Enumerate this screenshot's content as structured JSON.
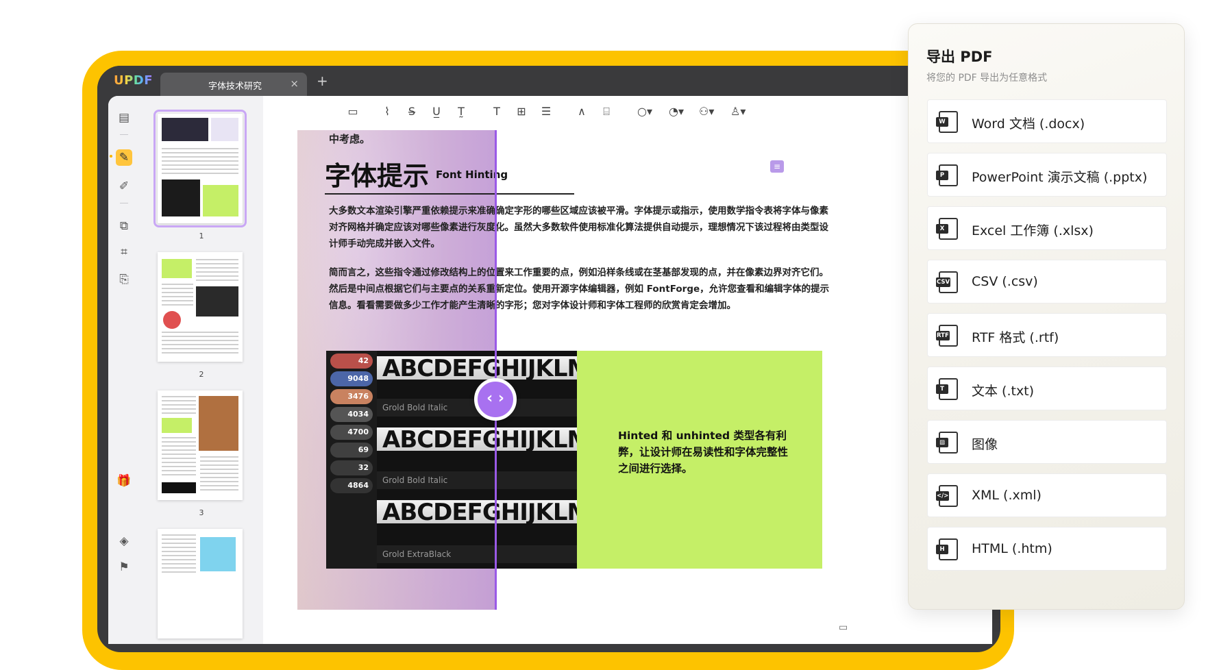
{
  "app": {
    "logo": "UPDF",
    "tab_title": "字体技术研究",
    "tab_close": "×",
    "tab_add": "+"
  },
  "thumbnails": [
    {
      "label": "1"
    },
    {
      "label": "2"
    },
    {
      "label": "3"
    }
  ],
  "page": {
    "top_line": "中考虑。",
    "title": "字体提示",
    "title_en": "Font Hinting",
    "paragraphs": [
      "大多数文本渲染引擎严重依赖提示来准确确定字形的哪些区域应该被平滑。字体提示或指示，使用数学指令表将字体与像素",
      "对齐网格并确定应该对哪些像素进行灰度化。虽然大多数软件使用标准化算法提供自动提示，理想情况下该过程将由类型设",
      "计师手动完成并嵌入文件。",
      "简而言之，这些指令通过修改结构上的位置来工作重要的点，例如沿样条线或在茎基部发现的点，并在像素边界对齐它们。",
      "然后是中间点根据它们与主要点的关系重新定位。使用开源字体编辑器，例如 FontForge，允许您查看和编辑字体的提示",
      "信息。看看需要做多少工作才能产生清晰的字形；您对字体设计师和字体工程师的欣赏肯定会增加。"
    ],
    "photo": {
      "counters": [
        "42",
        "9048",
        "3476",
        "4034",
        "4700",
        "69",
        "32",
        "4864"
      ],
      "rows": [
        {
          "text": "ABCDEFGHIJKLMNC",
          "sub": "Grold Bold Italic"
        },
        {
          "text": "ABCDEFGHIJKLMNC",
          "sub": "Grold Bold Italic"
        },
        {
          "text": "ABCDEFGHIJKLMNC",
          "sub": "Grold ExtraBlack"
        }
      ]
    },
    "lime_text": "Hinted 和 unhinted 类型各有利弊，让设计师在易读性和字体完整性之间进行选择。",
    "split_knob": "‹ ›"
  },
  "export_panel": {
    "title": "导出 PDF",
    "subtitle": "将您的 PDF 导出为任意格式",
    "options": [
      {
        "label": "Word 文档 (.docx)",
        "badge": "W",
        "icon": "word-icon"
      },
      {
        "label": "PowerPoint 演示文稿 (.pptx)",
        "badge": "P",
        "icon": "powerpoint-icon"
      },
      {
        "label": "Excel 工作簿 (.xlsx)",
        "badge": "X",
        "icon": "excel-icon"
      },
      {
        "label": "CSV (.csv)",
        "badge": "CSV",
        "icon": "csv-icon"
      },
      {
        "label": "RTF 格式 (.rtf)",
        "badge": "RTF",
        "icon": "rtf-icon"
      },
      {
        "label": "文本 (.txt)",
        "badge": "T",
        "icon": "text-icon"
      },
      {
        "label": "图像",
        "badge": "▨",
        "icon": "image-icon"
      },
      {
        "label": "XML (.xml)",
        "badge": "</>",
        "icon": "xml-icon"
      },
      {
        "label": "HTML (.htm)",
        "badge": "H",
        "icon": "html-icon"
      }
    ]
  },
  "colors": {
    "frame": "#fdc300",
    "device": "#3a3a3c",
    "accent_purple": "#9a5ae6",
    "lime": "#c5ef67",
    "active_tool": "#ffc53d"
  }
}
